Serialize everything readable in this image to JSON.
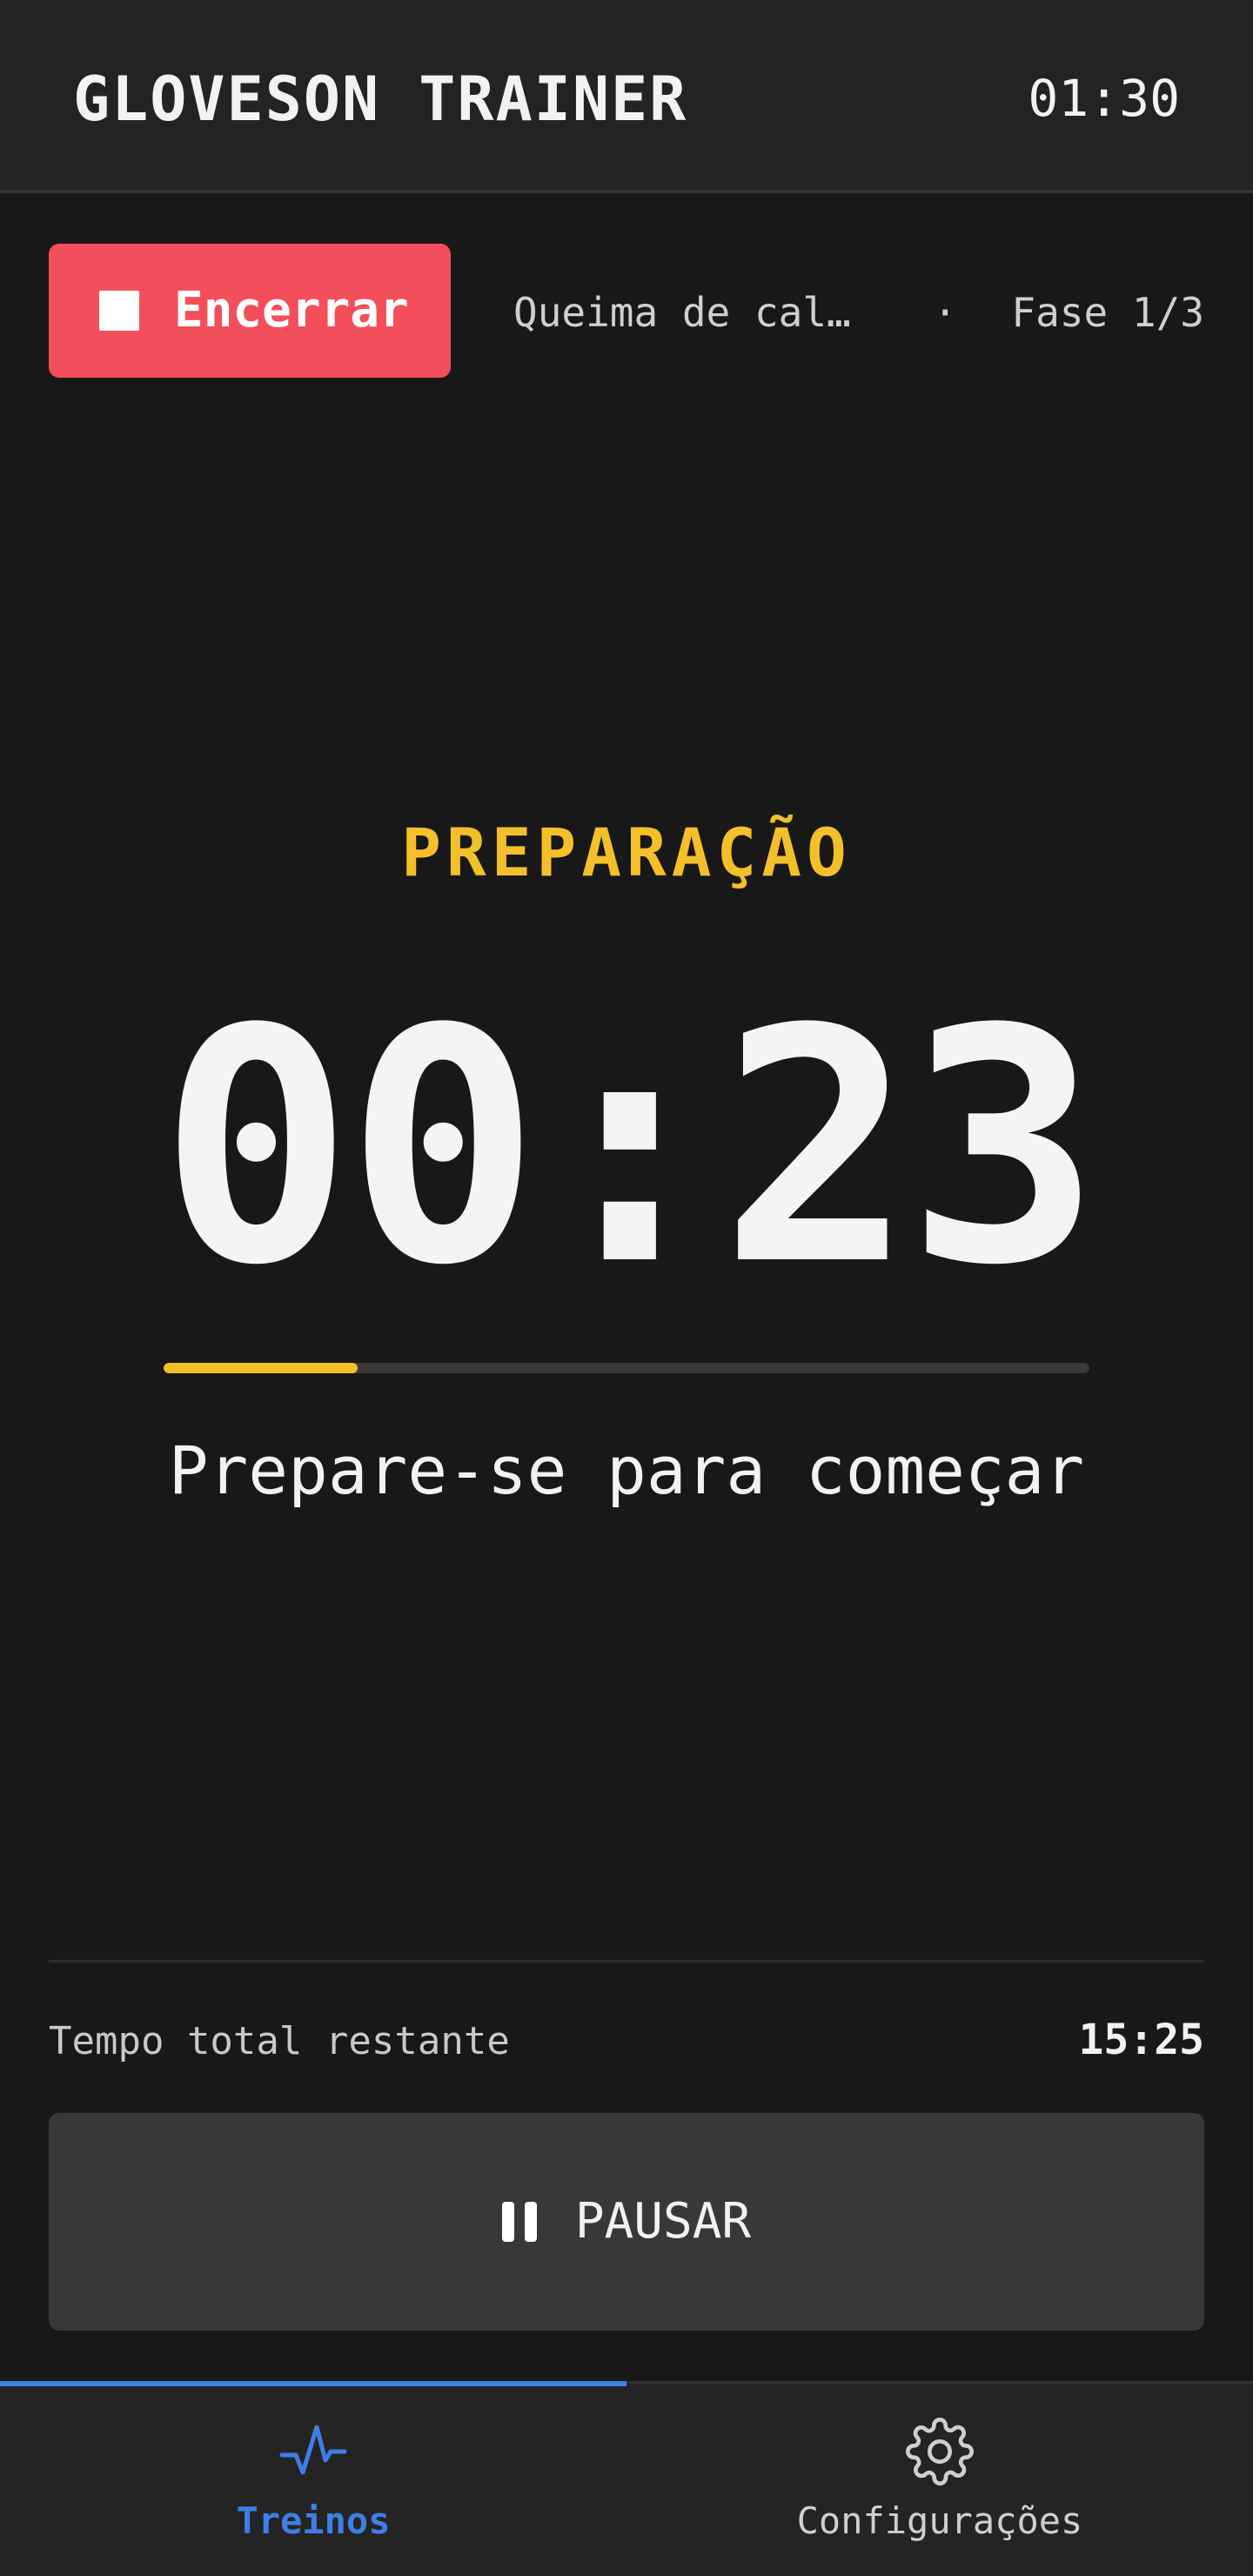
{
  "header": {
    "title": "GLOVESON TRAINER",
    "clock": "01:30"
  },
  "actions": {
    "end_label": "Encerrar",
    "workout_name": "Queima de cal…",
    "separator": "·",
    "phase_progress": "Fase 1/3"
  },
  "timer": {
    "phase_name": "PREPARAÇÃO",
    "time": "00:23",
    "progress_fraction": 0.21,
    "hint": "Prepare-se para começar"
  },
  "footer": {
    "remaining_label": "Tempo total restante",
    "remaining_value": "15:25",
    "pause_label": "PAUSAR"
  },
  "nav": {
    "items": [
      {
        "label": "Treinos",
        "icon": "activity-icon",
        "active": true
      },
      {
        "label": "Configurações",
        "icon": "gear-icon",
        "active": false
      }
    ]
  },
  "colors": {
    "accent": "#3d7fe6",
    "phase": "#f3bf2a",
    "danger": "#f24f5b",
    "background": "#181818"
  }
}
